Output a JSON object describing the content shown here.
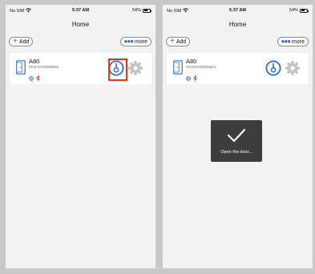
{
  "screens": [
    {
      "status": {
        "carrier": "No SIM",
        "time": "5:37 AM",
        "battery": "54%"
      },
      "title": "Home",
      "add_label": "Add",
      "more_label": "more",
      "device": {
        "name": "A80",
        "id": "FE1F0A0000D601"
      }
    },
    {
      "status": {
        "carrier": "No SIM",
        "time": "5:37 AM",
        "battery": "54%"
      },
      "title": "Home",
      "add_label": "Add",
      "more_label": "more",
      "device": {
        "name": "A80",
        "id": "FE1F0A0000D601"
      },
      "toast": "Open the door..."
    }
  ],
  "colors": {
    "accent": "#2c6fd6",
    "highlight": "#e8330f",
    "gear": "#c4c4c4",
    "bluetooth": "#e0373a"
  },
  "icons": [
    "wifi-icon",
    "battery-icon",
    "plus-icon",
    "dots-icon",
    "door-icon",
    "globe-icon",
    "bluetooth-icon",
    "unlock-icon",
    "gear-icon",
    "checkmark-icon"
  ]
}
